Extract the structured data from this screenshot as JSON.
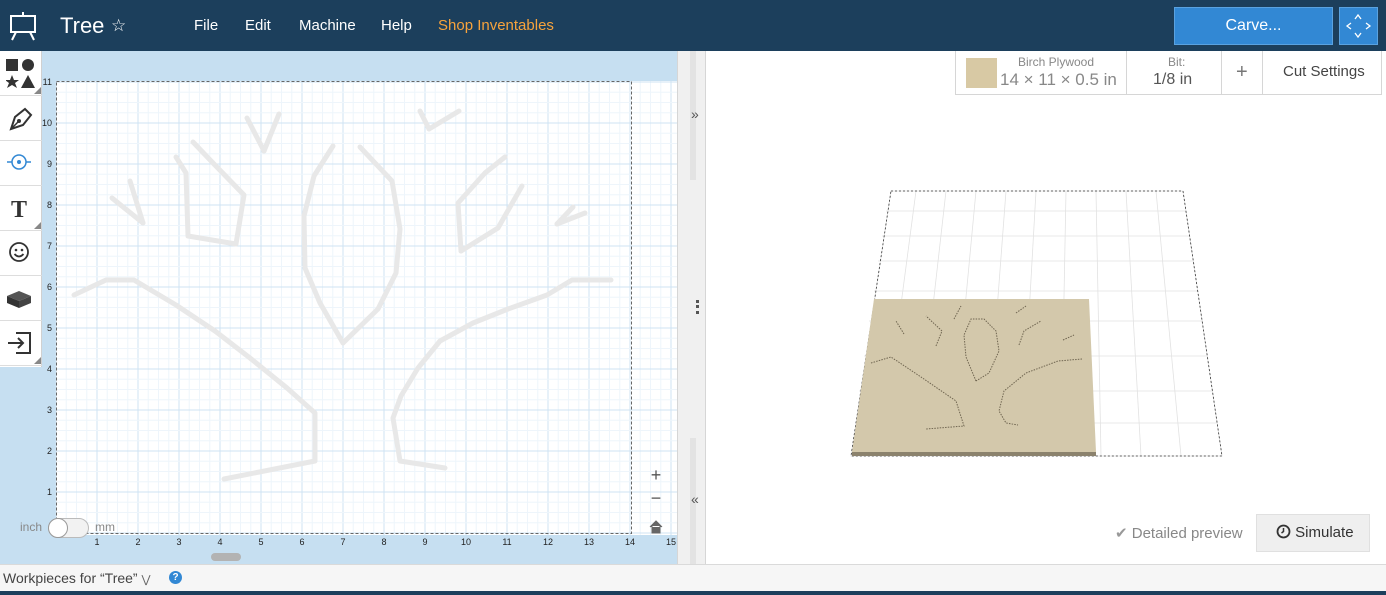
{
  "header": {
    "title": "Tree",
    "star": "☆",
    "menus": [
      "File",
      "Edit",
      "Machine",
      "Help"
    ],
    "shop_label": "Shop Inventables",
    "carve_label": "Carve..."
  },
  "canvas": {
    "units": {
      "inch": "inch",
      "mm": "mm"
    },
    "x_ticks": [
      "1",
      "2",
      "3",
      "4",
      "5",
      "6",
      "7",
      "8",
      "9",
      "10",
      "11",
      "12",
      "13",
      "14",
      "15"
    ],
    "y_ticks": [
      "1",
      "2",
      "3",
      "4",
      "5",
      "6",
      "7",
      "8",
      "9",
      "10",
      "11"
    ]
  },
  "material": {
    "name": "Birch Plywood",
    "dims": "14 × 11 × 0.5 in",
    "bit_label": "Bit:",
    "bit_value": "1/8 in",
    "add": "+",
    "cut_settings": "Cut Settings",
    "swatch_color": "#d8c9a4"
  },
  "preview": {
    "detailed_preview": "Detailed preview",
    "simulate": "Simulate"
  },
  "footer": {
    "workpieces": "Workpieces for “Tree”",
    "help": "?"
  },
  "colors": {
    "header_bg": "#1c3f5c",
    "accent": "#3288d4",
    "shop": "#f7a33c",
    "grid_bg": "#c6dff1"
  }
}
